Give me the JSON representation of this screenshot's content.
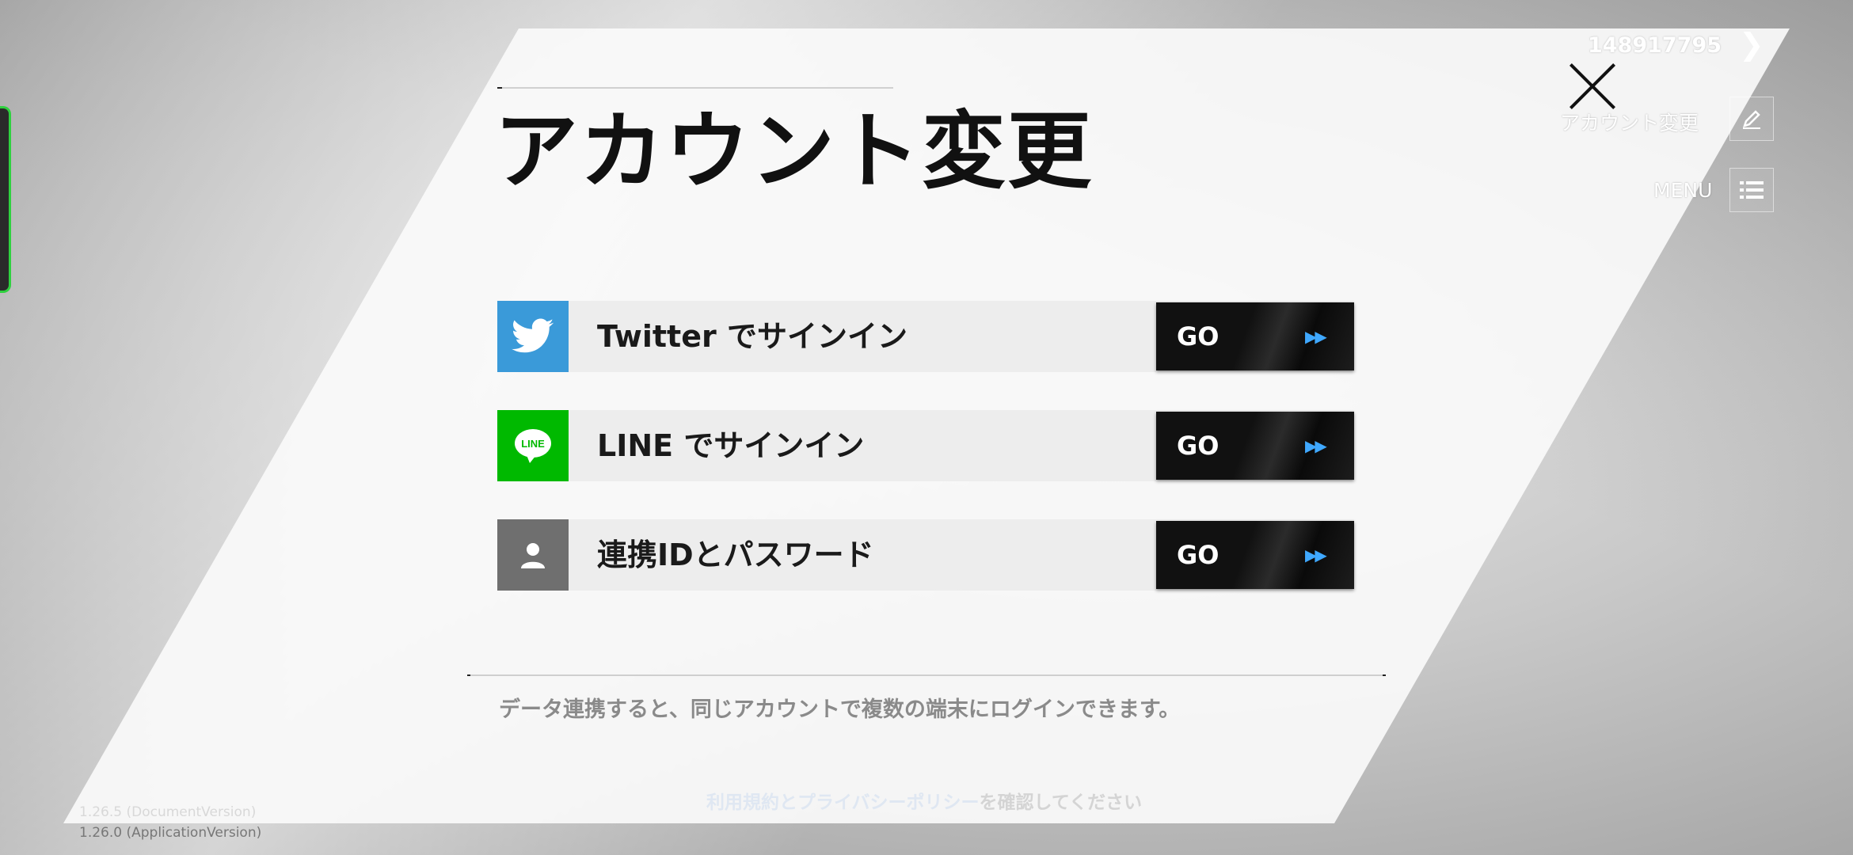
{
  "header": {
    "title": "アカウント変更",
    "user_id": "148917795",
    "user_id_arrow": "❯",
    "account_change_label": "アカウント変更",
    "menu_label": "MENU"
  },
  "signin_options": [
    {
      "label": "Twitter でサインイン",
      "button": "GO",
      "arrows": "▶▶",
      "color": "#3a9ad9"
    },
    {
      "label": "LINE でサインイン",
      "button": "GO",
      "arrows": "▶▶",
      "color": "#00b900"
    },
    {
      "label": "連携IDとパスワード",
      "button": "GO",
      "arrows": "▶▶",
      "color": "#6f6f6f"
    }
  ],
  "line_logo_text": "LINE",
  "note": "データ連携すると、同じアカウントで複数の端末にログインできます。",
  "policy": {
    "link_text": "利用規約とプライバシーポリシー",
    "suffix": "を確認してください"
  },
  "versions": {
    "document": "1.26.5 (DocumentVersion)",
    "application": "1.26.0 (ApplicationVersion)"
  },
  "icons": {
    "close": "close-icon",
    "edit": "pencil-icon",
    "menu": "menu-list-icon"
  }
}
